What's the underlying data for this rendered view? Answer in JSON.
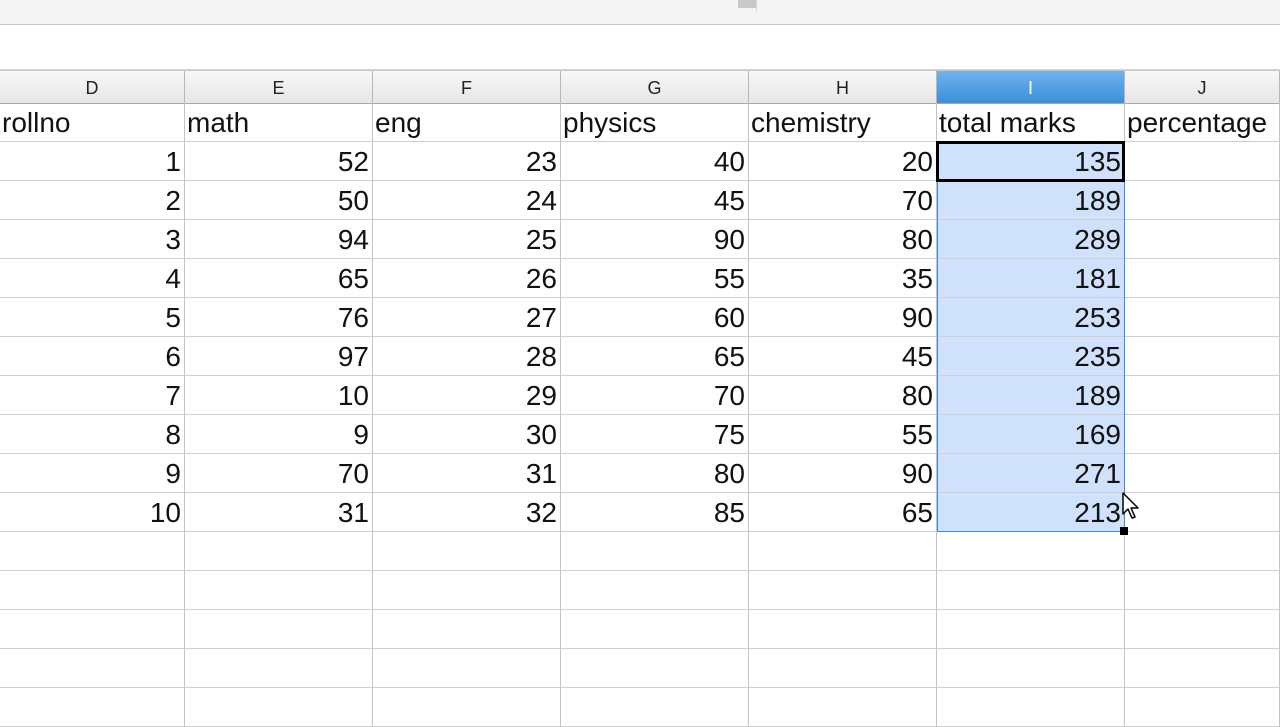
{
  "columns": [
    "D",
    "E",
    "F",
    "G",
    "H",
    "I",
    "J"
  ],
  "selected_column": "I",
  "header_row": [
    "rollno",
    "math",
    "eng",
    "physics",
    "chemistry",
    "total marks",
    "percentage"
  ],
  "rows": [
    [
      "1",
      "52",
      "23",
      "40",
      "20",
      "135",
      ""
    ],
    [
      "2",
      "50",
      "24",
      "45",
      "70",
      "189",
      ""
    ],
    [
      "3",
      "94",
      "25",
      "90",
      "80",
      "289",
      ""
    ],
    [
      "4",
      "65",
      "26",
      "55",
      "35",
      "181",
      ""
    ],
    [
      "5",
      "76",
      "27",
      "60",
      "90",
      "253",
      ""
    ],
    [
      "6",
      "97",
      "28",
      "65",
      "45",
      "235",
      ""
    ],
    [
      "7",
      "10",
      "29",
      "70",
      "80",
      "189",
      ""
    ],
    [
      "8",
      "9",
      "30",
      "75",
      "55",
      "169",
      ""
    ],
    [
      "9",
      "70",
      "31",
      "80",
      "90",
      "271",
      ""
    ],
    [
      "10",
      "31",
      "32",
      "85",
      "65",
      "213",
      ""
    ]
  ],
  "colors": {
    "selection_fill": "#cfe1fb",
    "selected_header": "#3c8fdc",
    "active_border": "#000000"
  },
  "icons": {
    "cursor": "mouse-pointer-icon"
  }
}
